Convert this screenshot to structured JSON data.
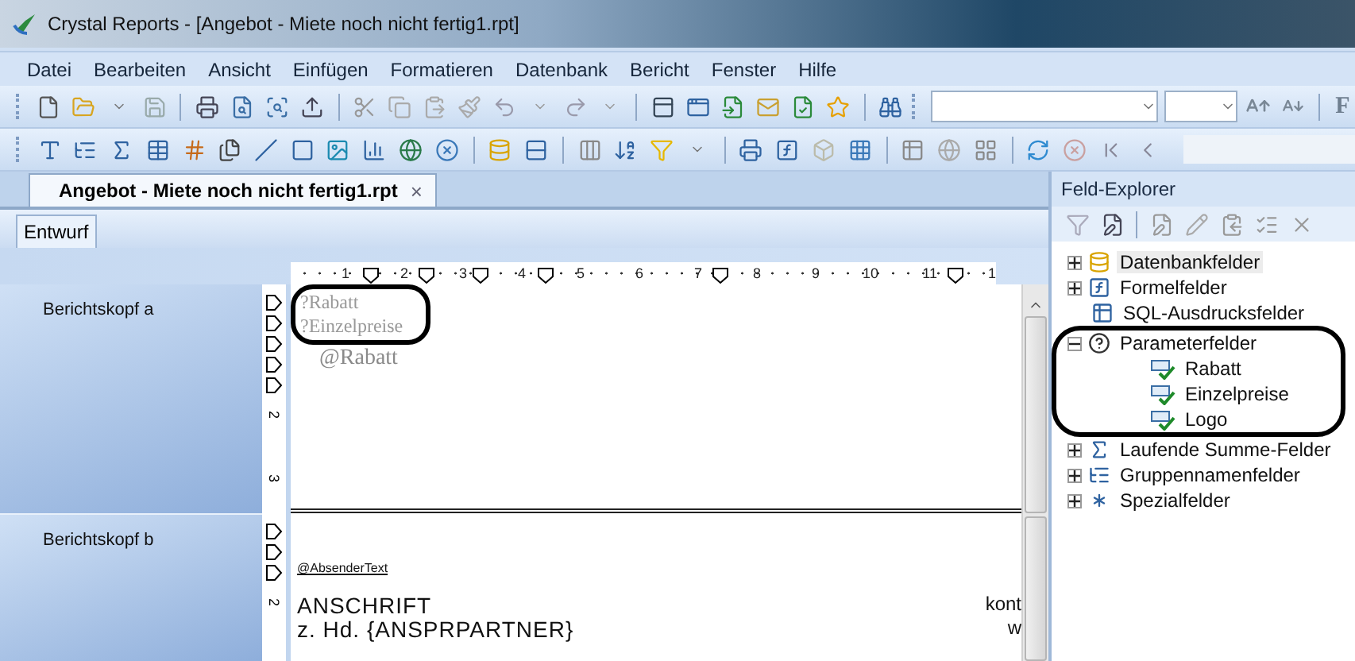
{
  "window": {
    "title": "Crystal Reports - [Angebot - Miete noch nicht fertig1.rpt]"
  },
  "menu": [
    "Datei",
    "Bearbeiten",
    "Ansicht",
    "Einfügen",
    "Formatieren",
    "Datenbank",
    "Bericht",
    "Fenster",
    "Hilfe"
  ],
  "toolbar": {
    "bold_button": "F"
  },
  "document_tabs": [
    {
      "label": "Angebot - Miete noch nicht fertig1.rpt",
      "selected": true,
      "close": "×"
    }
  ],
  "view_tabs": [
    {
      "label": "Entwurf",
      "selected": true
    }
  ],
  "ruler": [
    "1",
    "2",
    "3",
    "4",
    "5",
    "6",
    "7",
    "8",
    "9",
    "10",
    "11",
    "1"
  ],
  "sections": [
    {
      "name": "Berichtskopf a",
      "ruler_labels": [
        "2",
        "3"
      ],
      "fields": [
        {
          "text": "?Rabatt",
          "kind": "parameter"
        },
        {
          "text": "?Einzelpreise",
          "kind": "parameter"
        },
        {
          "text": "@Rabatt",
          "kind": "formula"
        }
      ]
    },
    {
      "name": "Berichtskopf b",
      "ruler_labels": [
        "2"
      ],
      "fields": [
        {
          "text": "@AbsenderText",
          "kind": "small"
        },
        {
          "text": "ANSCHRIFT",
          "kind": "text"
        },
        {
          "text": "z. Hd. {ANSPRPARTNER}",
          "kind": "text"
        }
      ],
      "side_fields": [
        {
          "text": "kont"
        },
        {
          "text": "w"
        }
      ]
    }
  ],
  "field_explorer": {
    "title": "Feld-Explorer",
    "items": [
      {
        "label": "Datenbankfelder",
        "kind": "database",
        "expanded": false,
        "selected": true
      },
      {
        "label": "Formelfelder",
        "kind": "formula",
        "expanded": false,
        "selected": false
      },
      {
        "label": "SQL-Ausdrucksfelder",
        "kind": "sql",
        "selected": false
      },
      {
        "label": "Parameterfelder",
        "kind": "parameter",
        "expanded": true,
        "selected": false,
        "children": [
          {
            "label": "Rabatt",
            "selected": false
          },
          {
            "label": "Einzelpreise",
            "selected": false
          },
          {
            "label": "Logo",
            "selected": false
          }
        ]
      },
      {
        "label": "Laufende Summe-Felder",
        "kind": "running",
        "expanded": false,
        "selected": false
      },
      {
        "label": "Gruppennamenfelder",
        "kind": "group",
        "expanded": false,
        "selected": false
      },
      {
        "label": "Spezialfelder",
        "kind": "special",
        "expanded": false,
        "selected": false
      }
    ]
  }
}
